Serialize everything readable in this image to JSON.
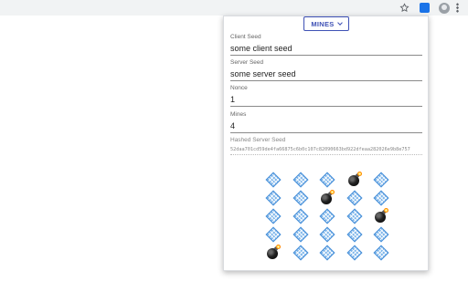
{
  "browser": {
    "icons": [
      "star-icon",
      "extension-icon",
      "profile-avatar-icon",
      "more-menu-icon"
    ]
  },
  "popup": {
    "game_selector": {
      "label": "MINES",
      "icon": "chevron-down-icon",
      "accent": "#3f51b5"
    },
    "fields": {
      "client_seed": {
        "label": "Client Seed",
        "value": "some client seed"
      },
      "server_seed": {
        "label": "Server Seed",
        "value": "some server seed"
      },
      "nonce": {
        "label": "Nonce",
        "value": "1"
      },
      "mines": {
        "label": "Mines",
        "value": "4"
      },
      "hashed_server_seed": {
        "label": "Hashed Server Seed",
        "value": "52daa701cd59de4fa66875c6b0c107c82090663bd922dfeaa282026e9b8e757"
      }
    },
    "board": {
      "columns": 5,
      "rows": 5,
      "tiles": [
        "gem",
        "gem",
        "gem",
        "bomb",
        "gem",
        "gem",
        "gem",
        "bomb",
        "gem",
        "gem",
        "gem",
        "gem",
        "gem",
        "gem",
        "bomb",
        "gem",
        "gem",
        "gem",
        "gem",
        "gem",
        "bomb",
        "gem",
        "gem",
        "gem",
        "gem"
      ],
      "gem_color": "#7fb6ea"
    }
  }
}
